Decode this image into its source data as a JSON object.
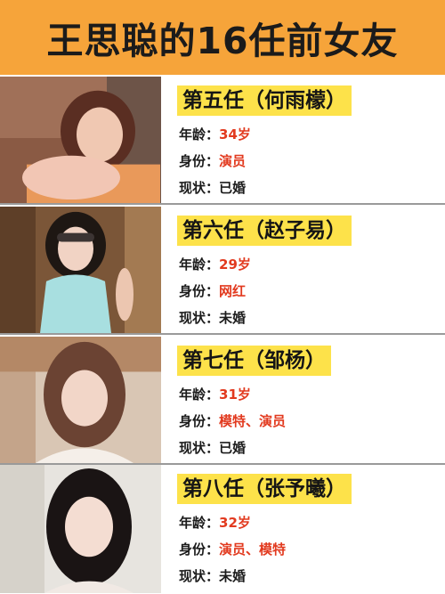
{
  "header": {
    "title": "王思聪的16任前女友"
  },
  "labels": {
    "age": "年龄：",
    "identity": "身份：",
    "status": "现状："
  },
  "colors": {
    "header_bg": "#f6a43a",
    "tag_bg": "#fde24a",
    "value_red": "#e23a1f"
  },
  "cards": [
    {
      "tag": "第五任（何雨檬）",
      "age": "34岁",
      "identity": "演员",
      "status": "已婚"
    },
    {
      "tag": "第六任（赵子易）",
      "age": "29岁",
      "identity": "网红",
      "status": "未婚"
    },
    {
      "tag": "第七任（邹杨）",
      "age": "31岁",
      "identity": "模特、演员",
      "status": "已婚"
    },
    {
      "tag": "第八任（张予曦）",
      "age": "32岁",
      "identity": "演员、模特",
      "status": "未婚"
    }
  ]
}
